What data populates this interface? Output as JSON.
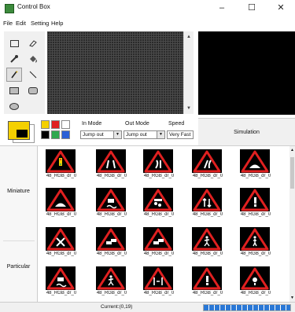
{
  "window": {
    "title": "Control Box",
    "minimize": "–",
    "maximize": "☐",
    "close": "✕"
  },
  "menu": [
    "File",
    "Edit",
    "Setting",
    "Help"
  ],
  "tools": [
    {
      "name": "rectangle-tool-icon",
      "glyph": "▭"
    },
    {
      "name": "eraser-tool-icon",
      "glyph": "⬭"
    },
    {
      "name": "eyedropper-tool-icon",
      "glyph": "✎"
    },
    {
      "name": "fill-tool-icon",
      "glyph": "◆"
    },
    {
      "name": "pencil-tool-icon",
      "glyph": "✏"
    },
    {
      "name": "line-tool-icon",
      "glyph": "＼"
    },
    {
      "name": "filled-rect-tool-icon",
      "glyph": "▬"
    },
    {
      "name": "rounded-rect-tool-icon",
      "glyph": "▢"
    },
    {
      "name": "ellipse-tool-icon",
      "glyph": "⬯"
    }
  ],
  "palette": [
    "#f5d000",
    "#e02020",
    "#ffffff",
    "#000000",
    "#2fa84f",
    "#2a5fd6"
  ],
  "in_mode": {
    "label": "In Mode",
    "value": "Jump out"
  },
  "out_mode": {
    "label": "Out Mode",
    "value": "Jump out"
  },
  "speed": {
    "label": "Speed",
    "value": "Very Fast"
  },
  "simulation_label": "Simulation",
  "sidebar": {
    "miniature": "Miniature",
    "particular": "Particular"
  },
  "sign_caption": "48_RGB_dr_0",
  "signs": [
    "traffic-light",
    "road-narrows",
    "double-bend",
    "bend",
    "speed-bump",
    "speed-bump",
    "slippery-road",
    "falling-rocks",
    "two-way-traffic",
    "danger",
    "crossroads",
    "car-crash",
    "car-crash",
    "road-works",
    "pedestrian",
    "slippery-road",
    "road-works",
    "narrow-bridge",
    "danger",
    "warning"
  ],
  "status": {
    "text": "Current:(0,19)",
    "progress": 1.0
  }
}
